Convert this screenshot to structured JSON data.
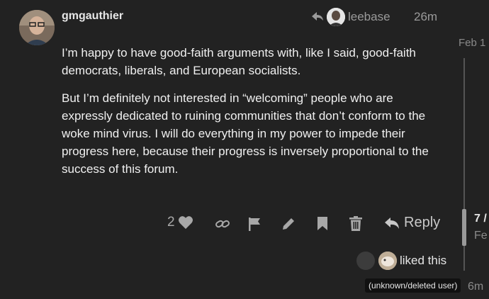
{
  "post": {
    "author": "gmgauthier",
    "reply_to": "leebase",
    "time": "26m",
    "paragraphs": [
      "I’m happy to have good-faith arguments with, like I said, good-faith democrats, liberals, and European socialists.",
      "But I’m definitely not interested in “welcoming” people who are expressly dedicated to ruining communities that don’t conform to the woke mind virus. I will do everything in my power to impede their progress here, because their progress is inversely proportional to the success of this forum."
    ]
  },
  "actions": {
    "like_count": "2",
    "reply_label": "Reply",
    "icons": [
      "heart-icon",
      "link-icon",
      "flag-icon",
      "pencil-icon",
      "bookmark-icon",
      "trash-icon",
      "reply-icon"
    ]
  },
  "likes": {
    "text": "liked this",
    "tooltip": "(unknown/deleted user)"
  },
  "timeline": {
    "top_date": "Feb 1",
    "count": "7 /",
    "month": "Fe",
    "bottom": "6m"
  },
  "colors": {
    "background": "#222222",
    "text": "#f0f0f0",
    "muted": "#9a9a9a"
  }
}
